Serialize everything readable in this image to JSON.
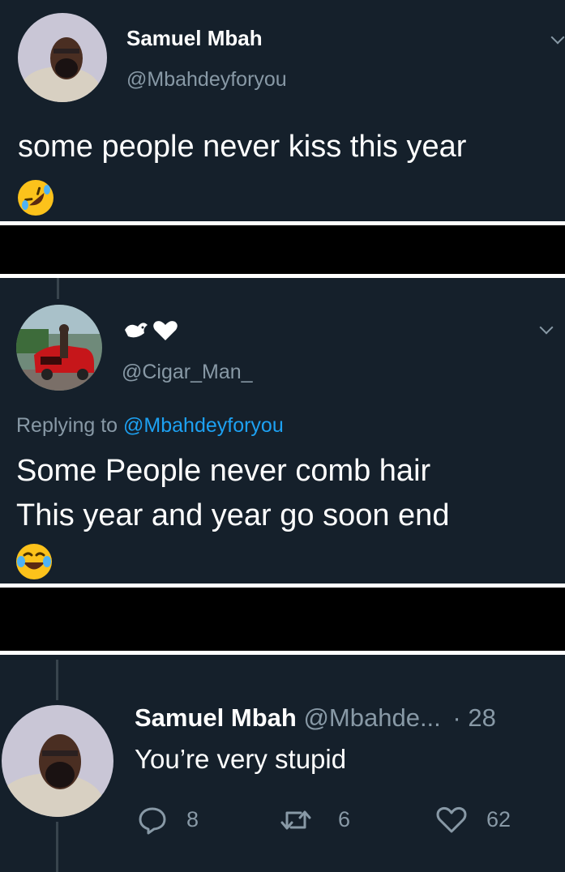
{
  "tweet1": {
    "name": "Samuel Mbah",
    "handle": "@Mbahdeyforyou",
    "text": "some people never kiss this year",
    "emoji": "rolling-on-floor-laughing-emoji"
  },
  "tweet2": {
    "name_emoji": "dove-heart-emoji",
    "handle": "@Cigar_Man_",
    "replying_prefix": "Replying to",
    "replying_handle": "@Mbahdeyforyou",
    "line1": "Some People never comb hair",
    "line2": "This year and year go soon end",
    "emoji": "tears-of-joy-emoji"
  },
  "tweet3": {
    "name": "Samuel Mbah",
    "handle": "@Mbahde...",
    "time": "· 28",
    "text": "You’re very stupid",
    "replies": "8",
    "retweets": "6",
    "likes": "62"
  },
  "colors": {
    "bg": "#15202b",
    "secondary": "#8899a6",
    "link": "#1da1f2"
  }
}
